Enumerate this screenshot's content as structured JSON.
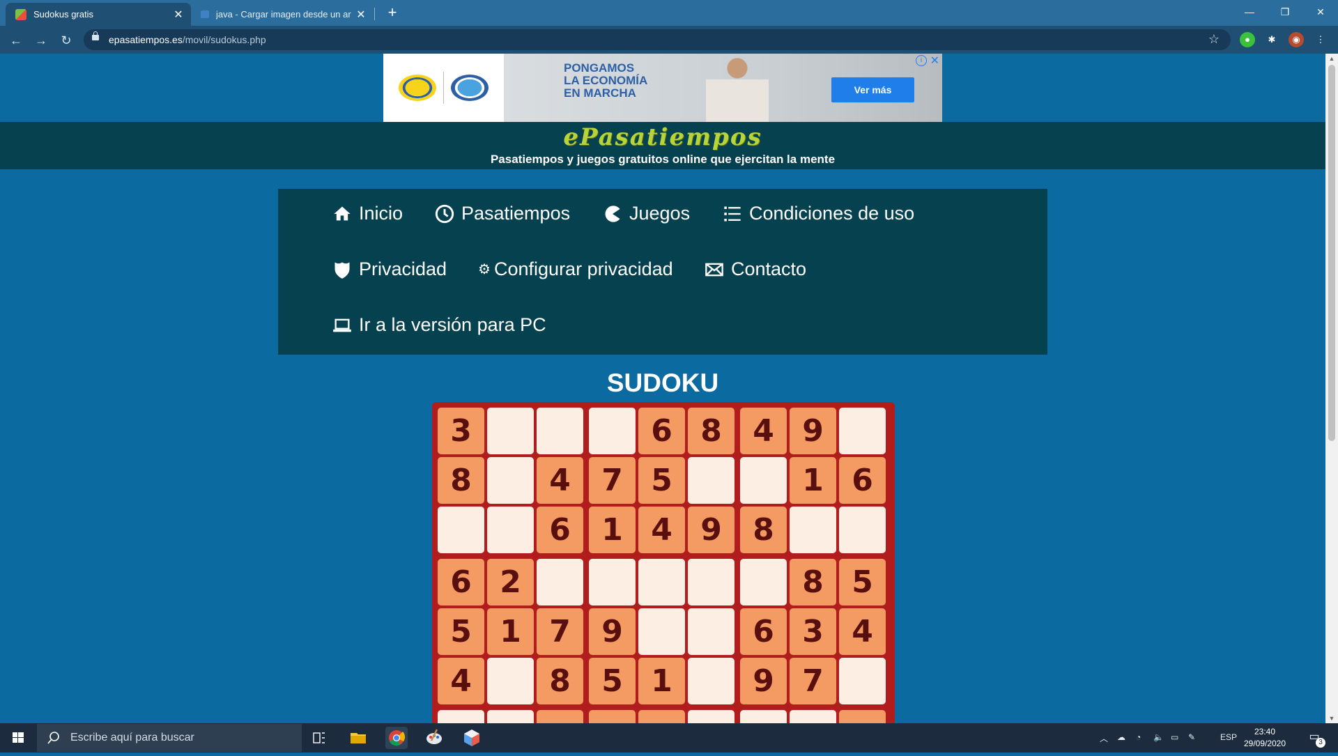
{
  "browser": {
    "tabs": [
      {
        "title": "Sudokus gratis",
        "active": true
      },
      {
        "title": "java - Cargar imagen desde un ar",
        "active": false
      }
    ],
    "url_domain": "epasatiempos.es",
    "url_path": "/movil/sudokus.php"
  },
  "ad": {
    "headline": "PONGAMOS\nLA ECONOMÍA\nEN MARCHA",
    "cta": "Ver más"
  },
  "site": {
    "logo": "ePasatiempos",
    "tagline": "Pasatiempos y juegos gratuitos online que ejercitan la mente"
  },
  "menu": {
    "items": [
      {
        "label": "Inicio",
        "icon": "home-icon"
      },
      {
        "label": "Pasatiempos",
        "icon": "clock-icon"
      },
      {
        "label": "Juegos",
        "icon": "pacman-icon"
      },
      {
        "label": "Condiciones de uso",
        "icon": "list-icon"
      },
      {
        "label": "Privacidad",
        "icon": "shield-icon"
      },
      {
        "label": "Configurar privacidad",
        "icon": "gear-icon"
      },
      {
        "label": "Contacto",
        "icon": "envelope-icon"
      },
      {
        "label": "Ir a la versión para PC",
        "icon": "laptop-icon"
      }
    ]
  },
  "sudoku": {
    "title": "SUDOKU",
    "rows": [
      [
        "3",
        "",
        "",
        "",
        "6",
        "8",
        "4",
        "9",
        ""
      ],
      [
        "8",
        "",
        "4",
        "7",
        "5",
        "",
        "",
        "1",
        "6"
      ],
      [
        "",
        "",
        "6",
        "1",
        "4",
        "9",
        "8",
        "",
        ""
      ],
      [
        "6",
        "2",
        "",
        "",
        "",
        "",
        "",
        "8",
        "5"
      ],
      [
        "5",
        "1",
        "7",
        "9",
        "",
        "",
        "6",
        "3",
        "4"
      ],
      [
        "4",
        "",
        "8",
        "5",
        "1",
        "",
        "9",
        "7",
        ""
      ]
    ]
  },
  "taskbar": {
    "search_placeholder": "Escribe aquí para buscar",
    "language": "ESP",
    "time": "23:40",
    "date": "29/09/2020",
    "notifications": "3"
  },
  "colors": {
    "page_bg": "#0b6aa0",
    "header_bg": "#06414f",
    "cell_given": "#f49a63",
    "cell_empty": "#fdeee4",
    "board_border": "#b11c1c"
  }
}
